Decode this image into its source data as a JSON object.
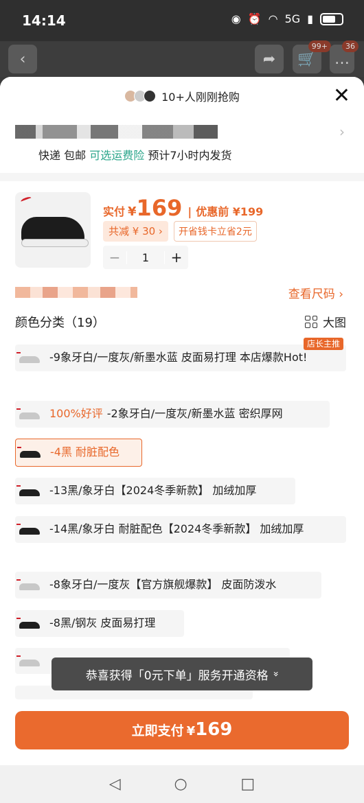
{
  "status": {
    "time": "14:14",
    "network": "5G"
  },
  "background": {
    "cart_badge": "99+",
    "msg_badge": "36"
  },
  "sheet": {
    "social_proof": "10+人刚刚抢购",
    "shipping": {
      "express": "快递",
      "free": "包邮",
      "insurance": "可选运费险",
      "eta": "预计7小时内发货"
    }
  },
  "product": {
    "price_label": "实付",
    "currency": "¥",
    "price": "169",
    "price_before": "优惠前 ¥199",
    "save_chip": "共减 ¥ 30 ›",
    "card_chip": "开省钱卡立省2元",
    "quantity": "1",
    "minus": "−",
    "plus": "+",
    "size_link": "查看尺码 ›",
    "color_heading": "颜色分类（19）",
    "big_image": "大图"
  },
  "options": [
    {
      "tag": "",
      "text": "-9象牙白/一度灰/新墨水蓝 皮面易打理 本店爆款Hot!",
      "badge": "店长主推",
      "shoe": "white"
    },
    {
      "tag": "100%好评",
      "text": "-2象牙白/一度灰/新墨水蓝 密织厚网",
      "badge": "",
      "shoe": "white"
    },
    {
      "tag": "",
      "text": "-4黑 耐脏配色",
      "badge": "",
      "shoe": "black",
      "selected": true
    },
    {
      "tag": "",
      "text": "-13黑/象牙白【2024冬季新款】 加绒加厚",
      "badge": "",
      "shoe": "black"
    },
    {
      "tag": "",
      "text": "-14黑/象牙白 耐脏配色【2024冬季新款】 加绒加厚",
      "badge": "",
      "shoe": "black"
    },
    {
      "tag": "",
      "text": "-8象牙白/一度灰【官方旗舰爆款】 皮面防泼水",
      "badge": "",
      "shoe": "white"
    },
    {
      "tag": "",
      "text": "-8黑/钢灰 皮面易打理",
      "badge": "",
      "shoe": "black"
    }
  ],
  "toast": {
    "text": "恭喜获得「0元下单」服务开通资格",
    "chevron": "»"
  },
  "pay": {
    "label": "立即支付",
    "currency": "¥",
    "amount": "169"
  },
  "colors": {
    "accent": "#e8672a",
    "green": "#2aa58a"
  }
}
